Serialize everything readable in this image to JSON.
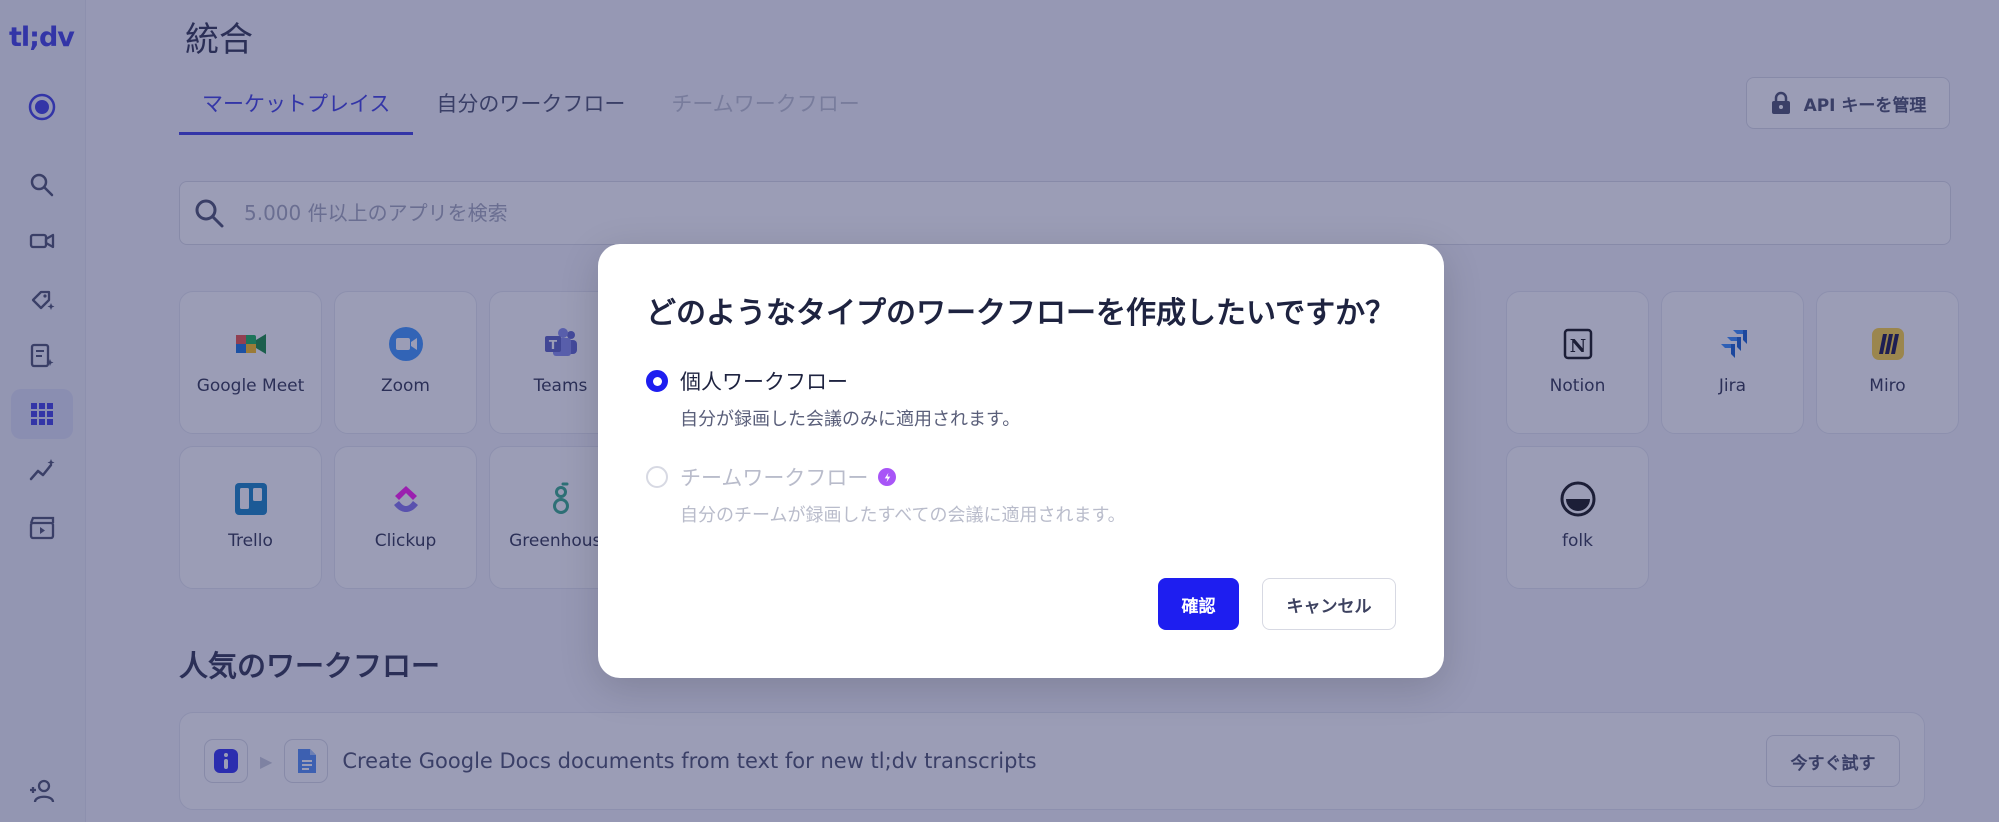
{
  "app": {
    "logo": "tl;dv"
  },
  "sidebar": {
    "items": [
      {
        "icon": "record-icon"
      },
      {
        "icon": "search-icon"
      },
      {
        "icon": "video-icon"
      },
      {
        "icon": "tag-sparkle-icon"
      },
      {
        "icon": "notes-edit-icon"
      },
      {
        "icon": "apps-grid-icon",
        "active": true
      },
      {
        "icon": "analytics-icon"
      },
      {
        "icon": "clapperboard-icon"
      },
      {
        "icon": "add-user-icon"
      }
    ]
  },
  "header": {
    "title": "統合",
    "tabs": [
      {
        "label": "マーケットプレイス",
        "state": "active"
      },
      {
        "label": "自分のワークフロー",
        "state": "normal"
      },
      {
        "label": "チームワークフロー",
        "state": "disabled"
      }
    ],
    "api_button": "API キーを管理"
  },
  "search": {
    "placeholder": "5.000 件以上のアプリを検索"
  },
  "apps": {
    "row1": [
      {
        "name": "Google Meet",
        "icon": "google-meet-icon",
        "color": "#00ac47"
      },
      {
        "name": "Zoom",
        "icon": "zoom-icon",
        "color": "#2d8cff"
      },
      {
        "name": "Teams",
        "icon": "teams-icon",
        "color": "#5059c9"
      },
      {
        "name": "Notion",
        "icon": "notion-icon",
        "color": "#000000"
      },
      {
        "name": "Jira",
        "icon": "jira-icon",
        "color": "#2684ff"
      },
      {
        "name": "Miro",
        "icon": "miro-icon",
        "color": "#ffd02f"
      }
    ],
    "row2": [
      {
        "name": "Trello",
        "icon": "trello-icon",
        "color": "#0079bf"
      },
      {
        "name": "Clickup",
        "icon": "clickup-icon",
        "color": "#7b68ee"
      },
      {
        "name": "Greenhouse",
        "icon": "greenhouse-icon",
        "color": "#24a47f"
      },
      {
        "name": "folk",
        "icon": "folk-icon",
        "color": "#000000"
      }
    ]
  },
  "popular": {
    "title": "人気のワークフロー",
    "items": [
      {
        "text": "Create Google Docs documents from text for new tl;dv transcripts",
        "button": "今すぐ試す"
      }
    ]
  },
  "modal": {
    "title": "どのようなタイプのワークフローを作成したいですか？",
    "options": [
      {
        "label": "個人ワークフロー",
        "description": "自分が録画した会議のみに適用されます。",
        "selected": true,
        "disabled": false
      },
      {
        "label": "チームワークフロー",
        "description": "自分のチームが録画したすべての会議に適用されます。",
        "selected": false,
        "disabled": true,
        "badge_icon": "bolt-icon"
      }
    ],
    "confirm": "確認",
    "cancel": "キャンセル"
  },
  "colors": {
    "accent": "#1e1ef0",
    "overlay": "#383c6e"
  }
}
